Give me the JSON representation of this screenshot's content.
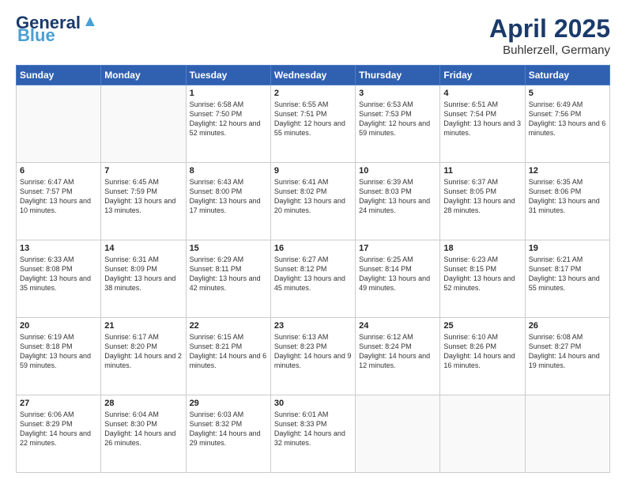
{
  "header": {
    "logo_line1": "General",
    "logo_line2": "Blue",
    "month_year": "April 2025",
    "location": "Buhlerzell, Germany"
  },
  "days_of_week": [
    "Sunday",
    "Monday",
    "Tuesday",
    "Wednesday",
    "Thursday",
    "Friday",
    "Saturday"
  ],
  "weeks": [
    [
      {
        "day": "",
        "info": ""
      },
      {
        "day": "",
        "info": ""
      },
      {
        "day": "1",
        "info": "Sunrise: 6:58 AM\nSunset: 7:50 PM\nDaylight: 12 hours and 52 minutes."
      },
      {
        "day": "2",
        "info": "Sunrise: 6:55 AM\nSunset: 7:51 PM\nDaylight: 12 hours and 55 minutes."
      },
      {
        "day": "3",
        "info": "Sunrise: 6:53 AM\nSunset: 7:53 PM\nDaylight: 12 hours and 59 minutes."
      },
      {
        "day": "4",
        "info": "Sunrise: 6:51 AM\nSunset: 7:54 PM\nDaylight: 13 hours and 3 minutes."
      },
      {
        "day": "5",
        "info": "Sunrise: 6:49 AM\nSunset: 7:56 PM\nDaylight: 13 hours and 6 minutes."
      }
    ],
    [
      {
        "day": "6",
        "info": "Sunrise: 6:47 AM\nSunset: 7:57 PM\nDaylight: 13 hours and 10 minutes."
      },
      {
        "day": "7",
        "info": "Sunrise: 6:45 AM\nSunset: 7:59 PM\nDaylight: 13 hours and 13 minutes."
      },
      {
        "day": "8",
        "info": "Sunrise: 6:43 AM\nSunset: 8:00 PM\nDaylight: 13 hours and 17 minutes."
      },
      {
        "day": "9",
        "info": "Sunrise: 6:41 AM\nSunset: 8:02 PM\nDaylight: 13 hours and 20 minutes."
      },
      {
        "day": "10",
        "info": "Sunrise: 6:39 AM\nSunset: 8:03 PM\nDaylight: 13 hours and 24 minutes."
      },
      {
        "day": "11",
        "info": "Sunrise: 6:37 AM\nSunset: 8:05 PM\nDaylight: 13 hours and 28 minutes."
      },
      {
        "day": "12",
        "info": "Sunrise: 6:35 AM\nSunset: 8:06 PM\nDaylight: 13 hours and 31 minutes."
      }
    ],
    [
      {
        "day": "13",
        "info": "Sunrise: 6:33 AM\nSunset: 8:08 PM\nDaylight: 13 hours and 35 minutes."
      },
      {
        "day": "14",
        "info": "Sunrise: 6:31 AM\nSunset: 8:09 PM\nDaylight: 13 hours and 38 minutes."
      },
      {
        "day": "15",
        "info": "Sunrise: 6:29 AM\nSunset: 8:11 PM\nDaylight: 13 hours and 42 minutes."
      },
      {
        "day": "16",
        "info": "Sunrise: 6:27 AM\nSunset: 8:12 PM\nDaylight: 13 hours and 45 minutes."
      },
      {
        "day": "17",
        "info": "Sunrise: 6:25 AM\nSunset: 8:14 PM\nDaylight: 13 hours and 49 minutes."
      },
      {
        "day": "18",
        "info": "Sunrise: 6:23 AM\nSunset: 8:15 PM\nDaylight: 13 hours and 52 minutes."
      },
      {
        "day": "19",
        "info": "Sunrise: 6:21 AM\nSunset: 8:17 PM\nDaylight: 13 hours and 55 minutes."
      }
    ],
    [
      {
        "day": "20",
        "info": "Sunrise: 6:19 AM\nSunset: 8:18 PM\nDaylight: 13 hours and 59 minutes."
      },
      {
        "day": "21",
        "info": "Sunrise: 6:17 AM\nSunset: 8:20 PM\nDaylight: 14 hours and 2 minutes."
      },
      {
        "day": "22",
        "info": "Sunrise: 6:15 AM\nSunset: 8:21 PM\nDaylight: 14 hours and 6 minutes."
      },
      {
        "day": "23",
        "info": "Sunrise: 6:13 AM\nSunset: 8:23 PM\nDaylight: 14 hours and 9 minutes."
      },
      {
        "day": "24",
        "info": "Sunrise: 6:12 AM\nSunset: 8:24 PM\nDaylight: 14 hours and 12 minutes."
      },
      {
        "day": "25",
        "info": "Sunrise: 6:10 AM\nSunset: 8:26 PM\nDaylight: 14 hours and 16 minutes."
      },
      {
        "day": "26",
        "info": "Sunrise: 6:08 AM\nSunset: 8:27 PM\nDaylight: 14 hours and 19 minutes."
      }
    ],
    [
      {
        "day": "27",
        "info": "Sunrise: 6:06 AM\nSunset: 8:29 PM\nDaylight: 14 hours and 22 minutes."
      },
      {
        "day": "28",
        "info": "Sunrise: 6:04 AM\nSunset: 8:30 PM\nDaylight: 14 hours and 26 minutes."
      },
      {
        "day": "29",
        "info": "Sunrise: 6:03 AM\nSunset: 8:32 PM\nDaylight: 14 hours and 29 minutes."
      },
      {
        "day": "30",
        "info": "Sunrise: 6:01 AM\nSunset: 8:33 PM\nDaylight: 14 hours and 32 minutes."
      },
      {
        "day": "",
        "info": ""
      },
      {
        "day": "",
        "info": ""
      },
      {
        "day": "",
        "info": ""
      }
    ]
  ]
}
